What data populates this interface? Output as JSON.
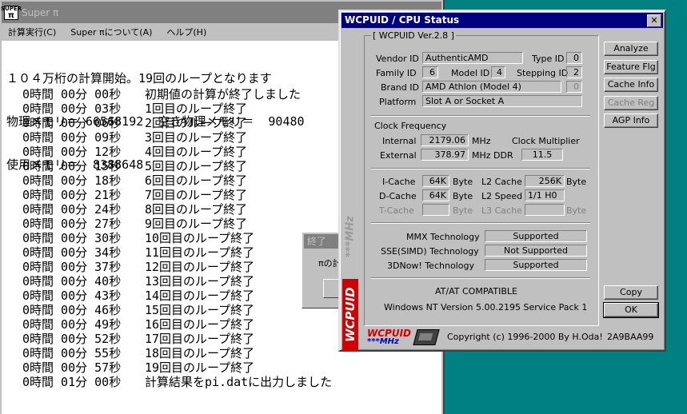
{
  "superpi": {
    "title": "Super π",
    "icon_text": "SUPER",
    "icon_pi": "π",
    "menu": [
      "計算実行(C)",
      "Super πについて(A)",
      "ヘルプ(H)"
    ],
    "header": [
      "１０４万桁の計算開始。19回のループとなります",
      "物理メモリ＝ 66568192  空き物理メモリ＝  90480",
      "使用メモリ＝  8388648"
    ],
    "lines": [
      {
        "time": "0時間 00分 00秒",
        "msg": "初期値の計算が終了しました"
      },
      {
        "time": "0時間 00分 03秒",
        "msg": "1回目のループ終了"
      },
      {
        "time": "0時間 00分 06秒",
        "msg": "2回目のループ終了"
      },
      {
        "time": "0時間 00分 09秒",
        "msg": "3回目のループ終了"
      },
      {
        "time": "0時間 00分 12秒",
        "msg": "4回目のループ終了"
      },
      {
        "time": "0時間 00分 15秒",
        "msg": "5回目のループ終了"
      },
      {
        "time": "0時間 00分 18秒",
        "msg": "6回目のループ終了"
      },
      {
        "time": "0時間 00分 21秒",
        "msg": "7回目のループ終了"
      },
      {
        "time": "0時間 00分 24秒",
        "msg": "8回目のループ終了"
      },
      {
        "time": "0時間 00分 27秒",
        "msg": "9回目のループ終了"
      },
      {
        "time": "0時間 00分 30秒",
        "msg": "10回目のループ終了"
      },
      {
        "time": "0時間 00分 34秒",
        "msg": "11回目のループ終了"
      },
      {
        "time": "0時間 00分 37秒",
        "msg": "12回目のループ終了"
      },
      {
        "time": "0時間 00分 40秒",
        "msg": "13回目のループ終了"
      },
      {
        "time": "0時間 00分 43秒",
        "msg": "14回目のループ終了"
      },
      {
        "time": "0時間 00分 46秒",
        "msg": "15回目のループ終了"
      },
      {
        "time": "0時間 00分 49秒",
        "msg": "16回目のループ終了"
      },
      {
        "time": "0時間 00分 52秒",
        "msg": "17回目のループ終了"
      },
      {
        "time": "0時間 00分 55秒",
        "msg": "18回目のループ終了"
      },
      {
        "time": "0時間 00分 57秒",
        "msg": "19回目のループ終了"
      },
      {
        "time": "0時間 01分 00秒",
        "msg": "計算結果をpi.datに出力しました"
      }
    ]
  },
  "dialog": {
    "title": "終了",
    "text": "πの計"
  },
  "wcpuid": {
    "title": "WCPUID / CPU Status",
    "close": "✕",
    "version_label": "[ WCPUID Ver.2.8 ]",
    "vendor_id_label": "Vendor ID",
    "vendor_id": "AuthenticAMD",
    "type_id_label": "Type ID",
    "type_id": "0",
    "family_id_label": "Family ID",
    "family_id": "6",
    "model_id_label": "Model ID",
    "model_id": "4",
    "stepping_id_label": "Stepping ID",
    "stepping_id": "2",
    "brand_id_label": "Brand ID",
    "brand_id": "AMD Athlon (Model 4)",
    "brand_num": "0",
    "platform_label": "Platform",
    "platform": "Slot A or Socket A",
    "clock_label": "Clock Frequency",
    "internal_label": "Internal",
    "internal": "2179.06",
    "internal_unit": "MHz",
    "multiplier_label": "Clock Multiplier",
    "external_label": "External",
    "external": "378.97",
    "external_unit": "MHz DDR",
    "multiplier": "11.5",
    "icache_label": "I-Cache",
    "icache": "64K",
    "icache_unit": "Byte",
    "l2cache_label": "L2 Cache",
    "l2cache": "256K",
    "l2cache_unit": "Byte",
    "dcache_label": "D-Cache",
    "dcache": "64K",
    "dcache_unit": "Byte",
    "l2speed_label": "L2 Speed",
    "l2speed": "1/1 H0",
    "tcache_label": "T-Cache",
    "tcache_unit": "Byte",
    "l3cache_label": "L3 Cache",
    "l3cache_unit": "Byte",
    "mmx_label": "MMX Technology",
    "mmx": "Supported",
    "sse_label": "SSE(SIMD) Technology",
    "sse": "Not Supported",
    "now3d_label": "3DNow! Technology",
    "now3d": "Supported",
    "compat": "AT/AT COMPATIBLE",
    "os": "Windows NT  Version 5.00.2195 Service Pack 1",
    "copyright": "Copyright (c) 1996-2000  By H.Oda!",
    "code": "2A9BAA99",
    "banner": "WCPUID",
    "banner_mhz": "***MHz",
    "logo1": "WCPUID",
    "logo2": "***MHz",
    "buttons": {
      "analyze": "Analyze",
      "feature": "Feature Flg",
      "cache_info": "Cache Info",
      "cache_reg": "Cache Reg",
      "agp": "AGP Info",
      "copy": "Copy",
      "ok": "OK"
    }
  }
}
